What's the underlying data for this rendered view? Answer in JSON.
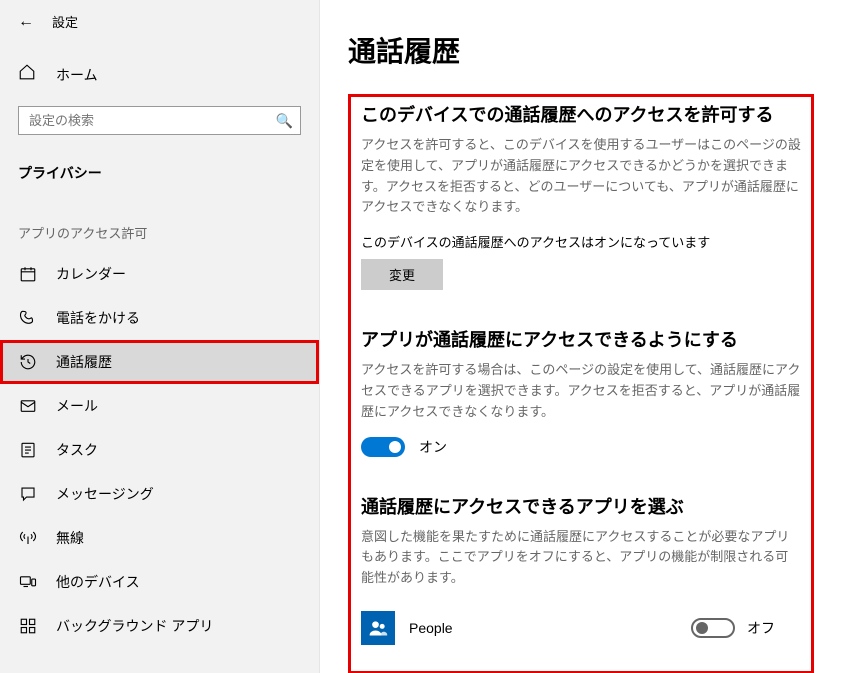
{
  "header": {
    "title": "設定"
  },
  "home": {
    "label": "ホーム"
  },
  "search": {
    "placeholder": "設定の検索"
  },
  "category": "プライバシー",
  "section_label": "アプリのアクセス許可",
  "nav": [
    {
      "id": "calendar",
      "label": "カレンダー",
      "selected": false,
      "highlighted": false
    },
    {
      "id": "phonecall",
      "label": "電話をかける",
      "selected": false,
      "highlighted": false
    },
    {
      "id": "callhistory",
      "label": "通話履歴",
      "selected": true,
      "highlighted": true
    },
    {
      "id": "mail",
      "label": "メール",
      "selected": false,
      "highlighted": false
    },
    {
      "id": "tasks",
      "label": "タスク",
      "selected": false,
      "highlighted": false
    },
    {
      "id": "messaging",
      "label": "メッセージング",
      "selected": false,
      "highlighted": false
    },
    {
      "id": "radio",
      "label": "無線",
      "selected": false,
      "highlighted": false
    },
    {
      "id": "otherdevices",
      "label": "他のデバイス",
      "selected": false,
      "highlighted": false
    },
    {
      "id": "background",
      "label": "バックグラウンド アプリ",
      "selected": false,
      "highlighted": false
    }
  ],
  "page": {
    "title": "通話履歴",
    "section1": {
      "title": "このデバイスでの通話履歴へのアクセスを許可する",
      "desc": "アクセスを許可すると、このデバイスを使用するユーザーはこのページの設定を使用して、アプリが通話履歴にアクセスできるかどうかを選択できます。アクセスを拒否すると、どのユーザーについても、アプリが通話履歴にアクセスできなくなります。",
      "status": "このデバイスの通話履歴へのアクセスはオンになっています",
      "change_btn": "変更"
    },
    "section2": {
      "title": "アプリが通話履歴にアクセスできるようにする",
      "desc": "アクセスを許可する場合は、このページの設定を使用して、通話履歴にアクセスできるアプリを選択できます。アクセスを拒否すると、アプリが通話履歴にアクセスできなくなります。",
      "toggle_label": "オン"
    },
    "section3": {
      "title": "通話履歴にアクセスできるアプリを選ぶ",
      "desc": "意図した機能を果たすために通話履歴にアクセスすることが必要なアプリもあります。ここでアプリをオフにすると、アプリの機能が制限される可能性があります。",
      "apps": [
        {
          "name": "People",
          "toggle_label": "オフ",
          "on": false
        }
      ]
    }
  }
}
